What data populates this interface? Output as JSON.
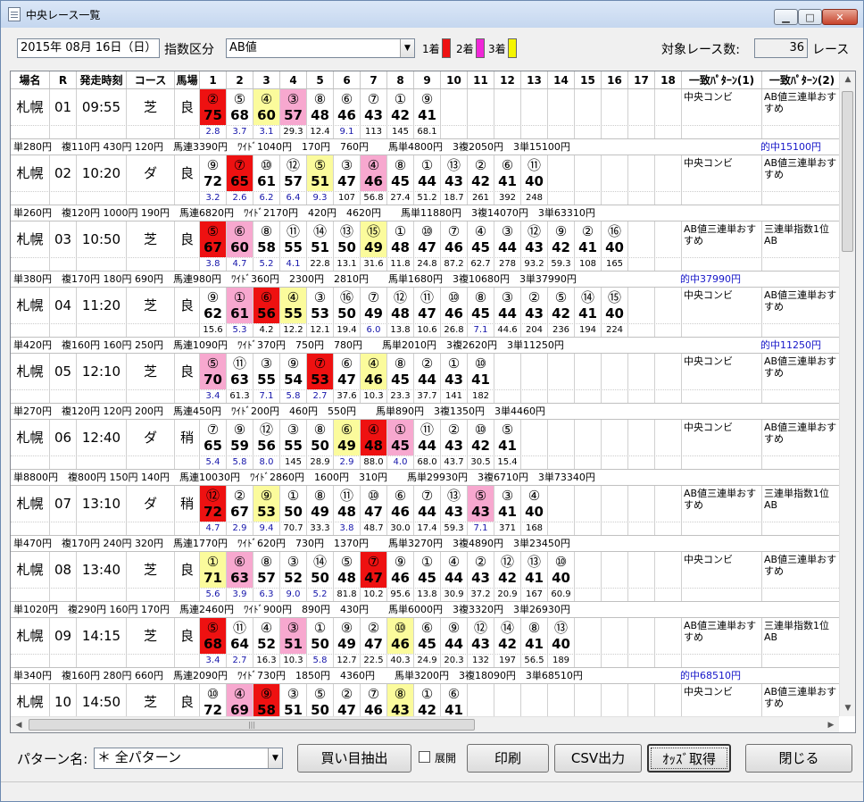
{
  "window": {
    "title": "中央レース一覧",
    "min_icon": "minimize-icon",
    "max_icon": "maximize-icon",
    "close_icon": "close-icon"
  },
  "toolbar": {
    "date": "2015年 08月 16日（日）",
    "index_label": "指数区分",
    "index_value": "AB値",
    "place1": "1着",
    "place2": "2着",
    "place3": "3着",
    "colors": {
      "first": "#ee1111",
      "second": "#f027d8",
      "third": "#f5f500"
    },
    "count_label": "対象レース数:",
    "count_value": "36",
    "count_unit": "レース"
  },
  "columns": [
    "場名",
    "R",
    "発走時刻",
    "コース",
    "馬場",
    "1",
    "2",
    "3",
    "4",
    "5",
    "6",
    "7",
    "8",
    "9",
    "10",
    "11",
    "12",
    "13",
    "14",
    "15",
    "16",
    "17",
    "18",
    "一致ﾊﾟﾀｰﾝ(1)",
    "一致ﾊﾟﾀｰﾝ(2)"
  ],
  "races": [
    {
      "venue": "札幌",
      "r": "01",
      "time": "09:55",
      "course": "芝1200",
      "track": "良",
      "horses": [
        {
          "n": "②",
          "v": "75",
          "odds": "2.8",
          "h": "win",
          "b": true
        },
        {
          "n": "⑤",
          "v": "68",
          "odds": "3.7",
          "b": true
        },
        {
          "n": "④",
          "v": "60",
          "odds": "3.1",
          "h": "thd",
          "b": true
        },
        {
          "n": "③",
          "v": "57",
          "odds": "29.3",
          "h": "sec"
        },
        {
          "n": "⑧",
          "v": "48",
          "odds": "12.4"
        },
        {
          "n": "⑥",
          "v": "46",
          "odds": "9.1",
          "b": true
        },
        {
          "n": "⑦",
          "v": "43",
          "odds": "113"
        },
        {
          "n": "①",
          "v": "42",
          "odds": "145"
        },
        {
          "n": "⑨",
          "v": "41",
          "odds": "68.1"
        }
      ],
      "pattern1": "中央コンビ",
      "pattern2": "AB値三連単おすすめ",
      "payout": "単280円　複110円 430円 120円　馬連3390円　ﾜｲﾄﾞ1040円　170円　760円　　馬単4800円　3複2050円　3単15100円",
      "hit": "的中15100円"
    },
    {
      "venue": "札幌",
      "r": "02",
      "time": "10:20",
      "course": "ダ1700",
      "track": "良",
      "horses": [
        {
          "n": "⑨",
          "v": "72",
          "odds": "3.2",
          "b": true
        },
        {
          "n": "⑦",
          "v": "65",
          "odds": "2.6",
          "h": "win",
          "b": true
        },
        {
          "n": "⑩",
          "v": "61",
          "odds": "6.2",
          "b": true
        },
        {
          "n": "⑫",
          "v": "57",
          "odds": "6.4",
          "b": true
        },
        {
          "n": "⑤",
          "v": "51",
          "odds": "9.3",
          "h": "thd",
          "b": true
        },
        {
          "n": "③",
          "v": "47",
          "odds": "107"
        },
        {
          "n": "④",
          "v": "46",
          "odds": "56.8",
          "h": "sec"
        },
        {
          "n": "⑧",
          "v": "45",
          "odds": "27.4"
        },
        {
          "n": "①",
          "v": "44",
          "odds": "51.2"
        },
        {
          "n": "⑬",
          "v": "43",
          "odds": "18.7"
        },
        {
          "n": "②",
          "v": "42",
          "odds": "261"
        },
        {
          "n": "⑥",
          "v": "41",
          "odds": "392"
        },
        {
          "n": "⑪",
          "v": "40",
          "odds": "248"
        }
      ],
      "pattern1": "中央コンビ",
      "pattern2": "AB値三連単おすすめ",
      "payout": "単260円　複120円 1000円 190円　馬連6820円　ﾜｲﾄﾞ2170円　420円　4620円　　馬単11880円　3複14070円　3単63310円",
      "hit": ""
    },
    {
      "venue": "札幌",
      "r": "03",
      "time": "10:50",
      "course": "芝1200",
      "track": "良",
      "horses": [
        {
          "n": "⑤",
          "v": "67",
          "odds": "3.8",
          "h": "win",
          "b": true
        },
        {
          "n": "⑥",
          "v": "60",
          "odds": "4.7",
          "h": "sec",
          "b": true
        },
        {
          "n": "⑧",
          "v": "58",
          "odds": "5.2",
          "b": true
        },
        {
          "n": "⑪",
          "v": "55",
          "odds": "4.1",
          "b": true
        },
        {
          "n": "⑭",
          "v": "51",
          "odds": "22.8"
        },
        {
          "n": "⑬",
          "v": "50",
          "odds": "13.1"
        },
        {
          "n": "⑮",
          "v": "49",
          "odds": "31.6",
          "h": "thd"
        },
        {
          "n": "①",
          "v": "48",
          "odds": "11.8"
        },
        {
          "n": "⑩",
          "v": "47",
          "odds": "24.8"
        },
        {
          "n": "⑦",
          "v": "46",
          "odds": "87.2"
        },
        {
          "n": "④",
          "v": "45",
          "odds": "62.7"
        },
        {
          "n": "③",
          "v": "44",
          "odds": "278"
        },
        {
          "n": "⑫",
          "v": "43",
          "odds": "93.2"
        },
        {
          "n": "⑨",
          "v": "42",
          "odds": "59.3"
        },
        {
          "n": "②",
          "v": "41",
          "odds": "108"
        },
        {
          "n": "⑯",
          "v": "40",
          "odds": "165"
        }
      ],
      "pattern1": "AB値三連単おすすめ",
      "pattern2": "三連単指数1位AB",
      "payout": "単380円　複170円 180円 690円　馬連980円　ﾜｲﾄﾞ360円　2300円　2810円　　馬単1680円　3複10680円　3単37990円",
      "hit": "的中37990円",
      "hitLeft": true
    },
    {
      "venue": "札幌",
      "r": "04",
      "time": "11:20",
      "course": "芝2000",
      "track": "良",
      "horses": [
        {
          "n": "⑨",
          "v": "62",
          "odds": "15.6"
        },
        {
          "n": "①",
          "v": "61",
          "odds": "5.3",
          "h": "sec",
          "b": true
        },
        {
          "n": "⑥",
          "v": "56",
          "odds": "4.2",
          "h": "win"
        },
        {
          "n": "④",
          "v": "55",
          "odds": "12.2",
          "h": "thd"
        },
        {
          "n": "③",
          "v": "53",
          "odds": "12.1"
        },
        {
          "n": "⑯",
          "v": "50",
          "odds": "19.4"
        },
        {
          "n": "⑦",
          "v": "49",
          "odds": "6.0",
          "b": true
        },
        {
          "n": "⑫",
          "v": "48",
          "odds": "13.8"
        },
        {
          "n": "⑪",
          "v": "47",
          "odds": "10.6"
        },
        {
          "n": "⑩",
          "v": "46",
          "odds": "26.8"
        },
        {
          "n": "⑧",
          "v": "45",
          "odds": "7.1",
          "b": true
        },
        {
          "n": "③",
          "v": "44",
          "odds": "44.6"
        },
        {
          "n": "②",
          "v": "43",
          "odds": "204"
        },
        {
          "n": "⑤",
          "v": "42",
          "odds": "236"
        },
        {
          "n": "⑭",
          "v": "41",
          "odds": "194"
        },
        {
          "n": "⑮",
          "v": "40",
          "odds": "224"
        }
      ],
      "pattern1": "中央コンビ",
      "pattern2": "AB値三連単おすすめ",
      "payout": "単420円　複160円 160円 250円　馬連1090円　ﾜｲﾄﾞ370円　750円　780円　　馬単2010円　3複2620円　3単11250円",
      "hit": "的中11250円"
    },
    {
      "venue": "札幌",
      "r": "05",
      "time": "12:10",
      "course": "芝1800",
      "track": "良",
      "horses": [
        {
          "n": "⑤",
          "v": "70",
          "odds": "3.4",
          "h": "sec",
          "b": true
        },
        {
          "n": "⑪",
          "v": "63",
          "odds": "61.3"
        },
        {
          "n": "③",
          "v": "55",
          "odds": "7.1",
          "b": true
        },
        {
          "n": "⑨",
          "v": "54",
          "odds": "5.8",
          "b": true
        },
        {
          "n": "⑦",
          "v": "53",
          "odds": "2.7",
          "h": "win",
          "b": true
        },
        {
          "n": "⑥",
          "v": "47",
          "odds": "37.6"
        },
        {
          "n": "④",
          "v": "46",
          "odds": "10.3",
          "h": "thd"
        },
        {
          "n": "⑧",
          "v": "45",
          "odds": "23.3"
        },
        {
          "n": "②",
          "v": "44",
          "odds": "37.7"
        },
        {
          "n": "①",
          "v": "43",
          "odds": "141"
        },
        {
          "n": "⑩",
          "v": "41",
          "odds": "182"
        }
      ],
      "pattern1": "中央コンビ",
      "pattern2": "AB値三連単おすすめ",
      "payout": "単270円　複120円 120円 200円　馬連450円　ﾜｲﾄﾞ200円　460円　550円　　馬単890円　3複1350円　3単4460円",
      "hit": ""
    },
    {
      "venue": "札幌",
      "r": "06",
      "time": "12:40",
      "course": "ダ1000",
      "track": "稍",
      "horses": [
        {
          "n": "⑦",
          "v": "65",
          "odds": "5.4",
          "b": true
        },
        {
          "n": "⑨",
          "v": "59",
          "odds": "5.8",
          "b": true
        },
        {
          "n": "⑫",
          "v": "56",
          "odds": "8.0",
          "b": true
        },
        {
          "n": "③",
          "v": "55",
          "odds": "145"
        },
        {
          "n": "⑧",
          "v": "50",
          "odds": "28.9"
        },
        {
          "n": "⑥",
          "v": "49",
          "odds": "2.9",
          "h": "thd",
          "b": true
        },
        {
          "n": "④",
          "v": "48",
          "odds": "88.0",
          "h": "win"
        },
        {
          "n": "①",
          "v": "45",
          "odds": "4.0",
          "h": "sec",
          "b": true
        },
        {
          "n": "⑪",
          "v": "44",
          "odds": "68.0"
        },
        {
          "n": "②",
          "v": "43",
          "odds": "43.7"
        },
        {
          "n": "⑩",
          "v": "42",
          "odds": "30.5"
        },
        {
          "n": "⑤",
          "v": "41",
          "odds": "15.4"
        }
      ],
      "pattern1": "中央コンビ",
      "pattern2": "AB値三連単おすすめ",
      "payout": "単8800円　複800円 150円 140円　馬連10030円　ﾜｲﾄﾞ2860円　1600円　310円　　馬単29930円　3複6710円　3単73340円",
      "hit": ""
    },
    {
      "venue": "札幌",
      "r": "07",
      "time": "13:10",
      "course": "ダ1700",
      "track": "稍",
      "horses": [
        {
          "n": "⑫",
          "v": "72",
          "odds": "4.7",
          "h": "win",
          "b": true
        },
        {
          "n": "②",
          "v": "67",
          "odds": "2.9",
          "b": true
        },
        {
          "n": "⑨",
          "v": "53",
          "odds": "9.4",
          "h": "thd",
          "b": true
        },
        {
          "n": "①",
          "v": "50",
          "odds": "70.7"
        },
        {
          "n": "⑧",
          "v": "49",
          "odds": "33.3"
        },
        {
          "n": "⑪",
          "v": "48",
          "odds": "3.8",
          "b": true
        },
        {
          "n": "⑩",
          "v": "47",
          "odds": "48.7"
        },
        {
          "n": "⑥",
          "v": "46",
          "odds": "30.0"
        },
        {
          "n": "⑦",
          "v": "44",
          "odds": "17.4"
        },
        {
          "n": "⑬",
          "v": "43",
          "odds": "59.3"
        },
        {
          "n": "⑤",
          "v": "43",
          "odds": "7.1",
          "h": "sec",
          "b": true
        },
        {
          "n": "③",
          "v": "41",
          "odds": "371"
        },
        {
          "n": "④",
          "v": "40",
          "odds": "168"
        }
      ],
      "pattern1": "AB値三連単おすすめ",
      "pattern2": "三連単指数1位AB",
      "payout": "単470円　複170円 240円 320円　馬連1770円　ﾜｲﾄﾞ620円　730円　1370円　　馬単3270円　3複4890円　3単23450円",
      "hit": ""
    },
    {
      "venue": "札幌",
      "r": "08",
      "time": "13:40",
      "course": "芝1500",
      "track": "良",
      "horses": [
        {
          "n": "①",
          "v": "71",
          "odds": "5.6",
          "h": "thd",
          "b": true
        },
        {
          "n": "⑥",
          "v": "63",
          "odds": "3.9",
          "h": "sec",
          "b": true
        },
        {
          "n": "⑧",
          "v": "57",
          "odds": "6.3",
          "b": true
        },
        {
          "n": "③",
          "v": "52",
          "odds": "9.0",
          "b": true
        },
        {
          "n": "⑭",
          "v": "50",
          "odds": "5.2",
          "b": true
        },
        {
          "n": "⑤",
          "v": "48",
          "odds": "81.8"
        },
        {
          "n": "⑦",
          "v": "47",
          "odds": "10.2",
          "h": "win"
        },
        {
          "n": "⑨",
          "v": "46",
          "odds": "95.6"
        },
        {
          "n": "①",
          "v": "45",
          "odds": "13.8"
        },
        {
          "n": "④",
          "v": "44",
          "odds": "30.9"
        },
        {
          "n": "②",
          "v": "43",
          "odds": "37.2"
        },
        {
          "n": "⑫",
          "v": "42",
          "odds": "20.9"
        },
        {
          "n": "⑬",
          "v": "41",
          "odds": "167"
        },
        {
          "n": "⑩",
          "v": "40",
          "odds": "60.9"
        }
      ],
      "pattern1": "中央コンビ",
      "pattern2": "AB値三連単おすすめ",
      "payout": "単1020円　複290円 160円 170円　馬連2460円　ﾜｲﾄﾞ900円　890円　430円　　馬単6000円　3複3320円　3単26930円",
      "hit": ""
    },
    {
      "venue": "札幌",
      "r": "09",
      "time": "14:15",
      "course": "芝1800",
      "track": "良",
      "horses": [
        {
          "n": "⑤",
          "v": "68",
          "odds": "3.4",
          "h": "win",
          "b": true
        },
        {
          "n": "⑪",
          "v": "64",
          "odds": "2.7",
          "b": true
        },
        {
          "n": "④",
          "v": "52",
          "odds": "16.3"
        },
        {
          "n": "③",
          "v": "51",
          "odds": "10.3",
          "h": "sec"
        },
        {
          "n": "①",
          "v": "50",
          "odds": "5.8",
          "b": true
        },
        {
          "n": "⑨",
          "v": "49",
          "odds": "12.7"
        },
        {
          "n": "②",
          "v": "47",
          "odds": "22.5"
        },
        {
          "n": "⑩",
          "v": "46",
          "odds": "40.3",
          "h": "thd"
        },
        {
          "n": "⑥",
          "v": "45",
          "odds": "24.9"
        },
        {
          "n": "⑨",
          "v": "44",
          "odds": "20.3"
        },
        {
          "n": "⑫",
          "v": "43",
          "odds": "132"
        },
        {
          "n": "⑭",
          "v": "42",
          "odds": "197"
        },
        {
          "n": "⑧",
          "v": "41",
          "odds": "56.5"
        },
        {
          "n": "⑬",
          "v": "40",
          "odds": "189"
        }
      ],
      "pattern1": "AB値三連単おすすめ",
      "pattern2": "三連単指数1位AB",
      "payout": "単340円　複160円 280円 660円　馬連2090円　ﾜｲﾄﾞ730円　1850円　4360円　　馬単3200円　3複18090円　3単68510円",
      "hit": "的中68510円",
      "hitLeft": true
    },
    {
      "venue": "札幌",
      "r": "10",
      "time": "14:50",
      "course": "芝2000",
      "track": "良",
      "horses": [
        {
          "n": "⑩",
          "v": "72"
        },
        {
          "n": "④",
          "v": "69",
          "h": "sec"
        },
        {
          "n": "⑨",
          "v": "58",
          "h": "win"
        },
        {
          "n": "③",
          "v": "51"
        },
        {
          "n": "⑤",
          "v": "50"
        },
        {
          "n": "②",
          "v": "47"
        },
        {
          "n": "⑦",
          "v": "46"
        },
        {
          "n": "⑧",
          "v": "43",
          "h": "thd"
        },
        {
          "n": "①",
          "v": "42"
        },
        {
          "n": "⑥",
          "v": "41"
        }
      ],
      "pattern1": "中央コンビ",
      "pattern2": "AB値三連単おすすめ",
      "payout": "",
      "hit": ""
    }
  ],
  "bottom": {
    "pattern_label": "パターン名:",
    "pattern_value": "＊ 全パターン",
    "extract_label": "買い目抽出",
    "expand_label": "展開",
    "print_label": "印刷",
    "csv_label": "CSV出力",
    "odds_label": "ｵｯｽﾞ取得",
    "close_label": "閉じる"
  }
}
